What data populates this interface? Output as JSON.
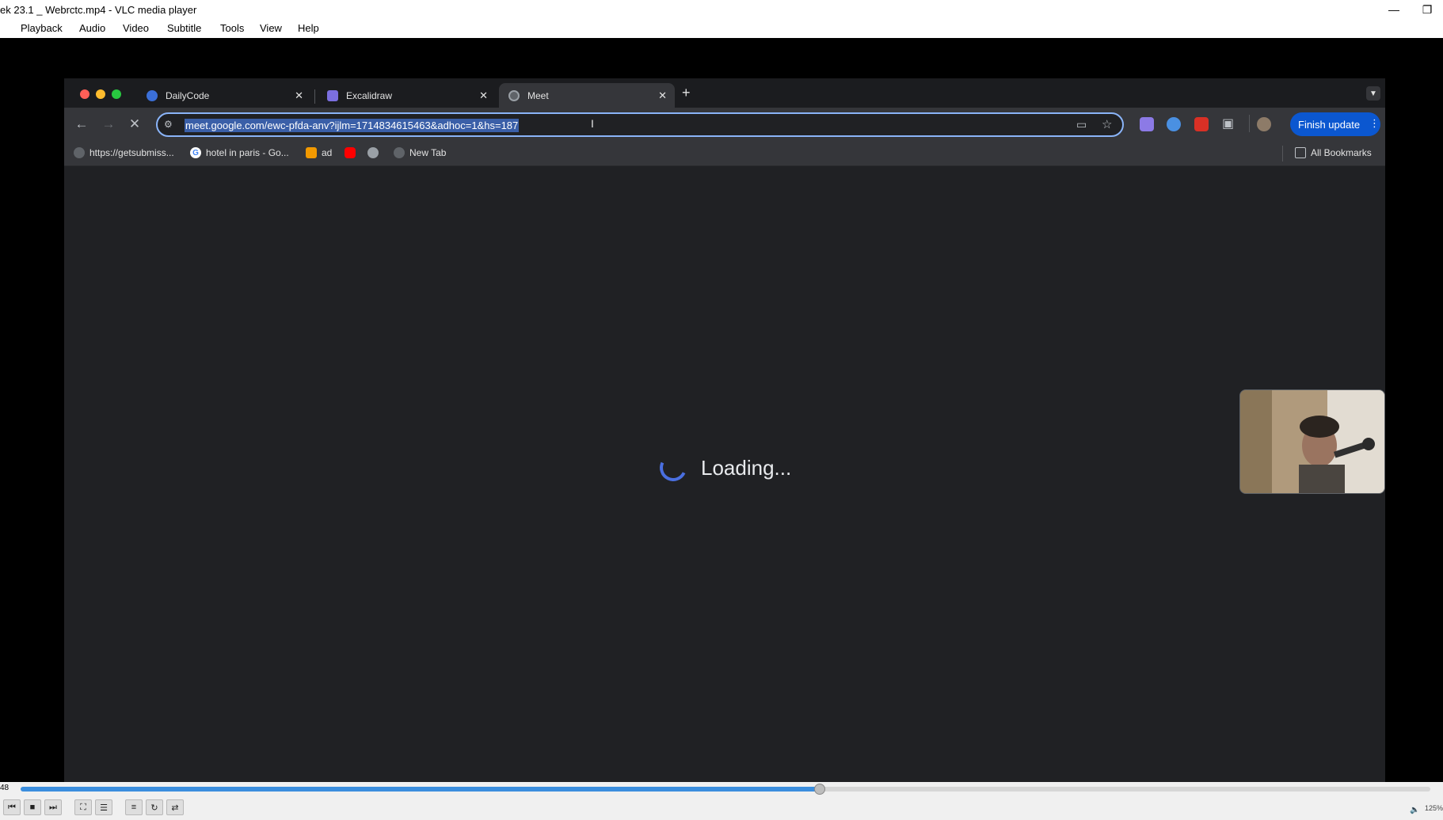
{
  "vlc": {
    "title": "ek 23.1 _ Webrctc.mp4 - VLC media player",
    "menu": [
      "Playback",
      "Audio",
      "Video",
      "Subtitle",
      "Tools",
      "View",
      "Help"
    ],
    "time_elapsed": "48",
    "progress": 0.567,
    "volume_pct": "125%"
  },
  "browser": {
    "tabs": [
      {
        "label": "DailyCode",
        "active": false
      },
      {
        "label": "Excalidraw",
        "active": false
      },
      {
        "label": "Meet",
        "active": true
      }
    ],
    "url": "meet.google.com/ewc-pfda-anv?ijlm=1714834615463&adhoc=1&hs=187",
    "finish_update_label": "Finish update",
    "bookmarks": [
      {
        "label": "https://getsubmiss..."
      },
      {
        "label": "hotel in paris - Go..."
      },
      {
        "label": "ad"
      },
      {
        "label": ""
      },
      {
        "label": ""
      },
      {
        "label": "New Tab"
      }
    ],
    "all_bookmarks_label": "All Bookmarks"
  },
  "page": {
    "loading_text": "Loading..."
  },
  "colors": {
    "accent": "#8ab4f8",
    "finish_update_bg": "#0b57d0",
    "page_bg": "#202124",
    "seek_fill": "#3b8ede"
  }
}
